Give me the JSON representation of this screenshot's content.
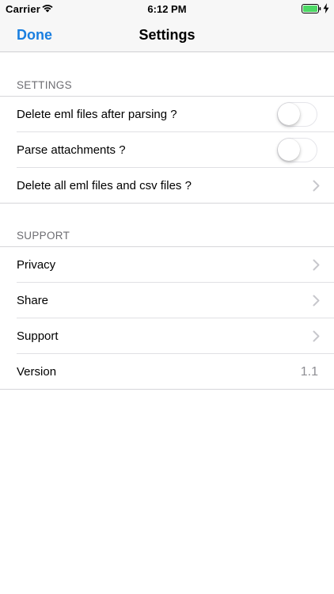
{
  "status_bar": {
    "carrier": "Carrier",
    "time": "6:12 PM",
    "battery_color": "#4cd964",
    "icons": [
      "wifi-icon",
      "battery-icon",
      "charging-bolt-icon"
    ]
  },
  "nav": {
    "done_label": "Done",
    "title": "Settings",
    "accent_color": "#1a7fe0"
  },
  "sections": {
    "settings": {
      "header": "SETTINGS",
      "rows": {
        "delete_eml": {
          "label": "Delete eml files after parsing ?",
          "toggle_on": false
        },
        "parse_attachments": {
          "label": "Parse attachments ?",
          "toggle_on": false
        },
        "delete_all": {
          "label": "Delete all eml files and csv files ?",
          "accessory": "chevron-right-icon"
        }
      }
    },
    "support": {
      "header": "SUPPORT",
      "rows": {
        "privacy": {
          "label": "Privacy",
          "accessory": "chevron-right-icon"
        },
        "share": {
          "label": "Share",
          "accessory": "chevron-right-icon"
        },
        "support": {
          "label": "Support",
          "accessory": "chevron-right-icon"
        },
        "version": {
          "label": "Version",
          "value": "1.1"
        }
      }
    }
  }
}
